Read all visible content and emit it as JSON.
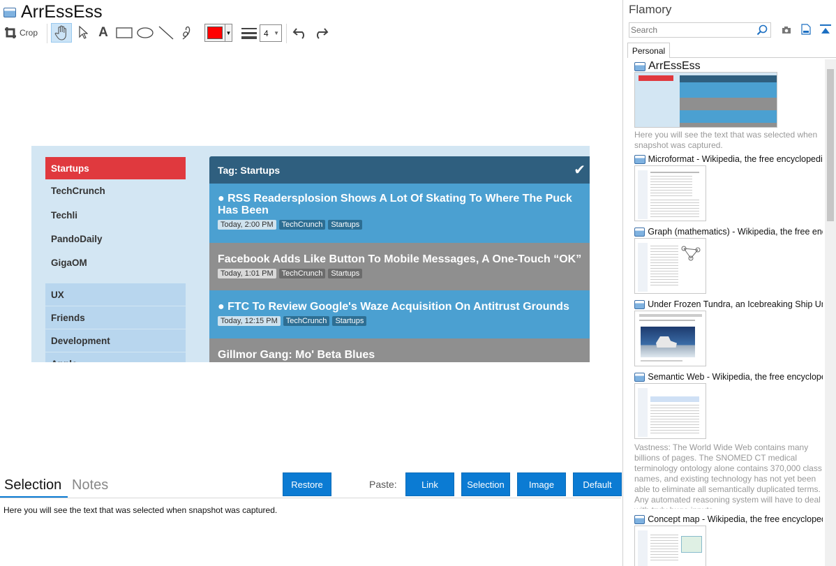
{
  "document": {
    "title": "ArrEssEss"
  },
  "toolbar": {
    "crop_label": "Crop",
    "line_width": "4",
    "color": "#ff0000",
    "tools": [
      "pan",
      "select",
      "text",
      "rectangle",
      "ellipse",
      "line",
      "freehand"
    ]
  },
  "capture": {
    "sidebar": {
      "active": "Startups",
      "items": [
        "TechCrunch",
        "Techli",
        "PandoDaily",
        "GigaOM"
      ],
      "groups": [
        "UX",
        "Friends",
        "Development",
        "Apple"
      ]
    },
    "header": "Tag: Startups",
    "feed": [
      {
        "title": "● RSS Readersplosion Shows A Lot Of Skating To Where The Puck Has Been",
        "date": "Today, 2:00 PM",
        "tags": [
          "TechCrunch",
          "Startups"
        ]
      },
      {
        "title": "Facebook Adds Like Button To Mobile Messages, A One-Touch “OK”",
        "date": "Today, 1:01 PM",
        "tags": [
          "TechCrunch",
          "Startups"
        ]
      },
      {
        "title": "● FTC To Review Google's Waze Acquisition On Antitrust Grounds",
        "date": "Today, 12:15 PM",
        "tags": [
          "TechCrunch",
          "Startups"
        ]
      },
      {
        "title": "Gillmor Gang: Mo' Beta Blues",
        "date": "",
        "tags": []
      }
    ]
  },
  "bottom": {
    "tabs": [
      "Selection",
      "Notes"
    ],
    "restore": "Restore",
    "paste_label": "Paste:",
    "paste_buttons": [
      "Link",
      "Selection",
      "Image",
      "Default"
    ],
    "selection_text": "Here you will see the text that was selected when snapshot was captured."
  },
  "sidebar": {
    "app_name": "Flamory",
    "search_placeholder": "Search",
    "tab": "Personal",
    "entries": [
      {
        "title": "ArrEssEss",
        "snippet": "Here you will see the text that was selected when snapshot was captured."
      },
      {
        "title": "Microformat - Wikipedia, the free encyclopedia",
        "snippet": ""
      },
      {
        "title": "Graph (mathematics) - Wikipedia, the free ency",
        "snippet": ""
      },
      {
        "title": "Under Frozen Tundra, an Icebreaking Ship Unco",
        "snippet": ""
      },
      {
        "title": "Semantic Web - Wikipedia, the free encycloped",
        "snippet": "Vastness: The World Wide Web contains many billions of pages. The SNOMED CT medical terminology ontology alone contains 370,000 class names, and existing technology has not yet been able to eliminate all semantically duplicated terms. Any automated reasoning system will have to deal with truly huge inputs."
      },
      {
        "title": "Concept map - Wikipedia, the free encyclopedia",
        "snippet": ""
      }
    ]
  }
}
